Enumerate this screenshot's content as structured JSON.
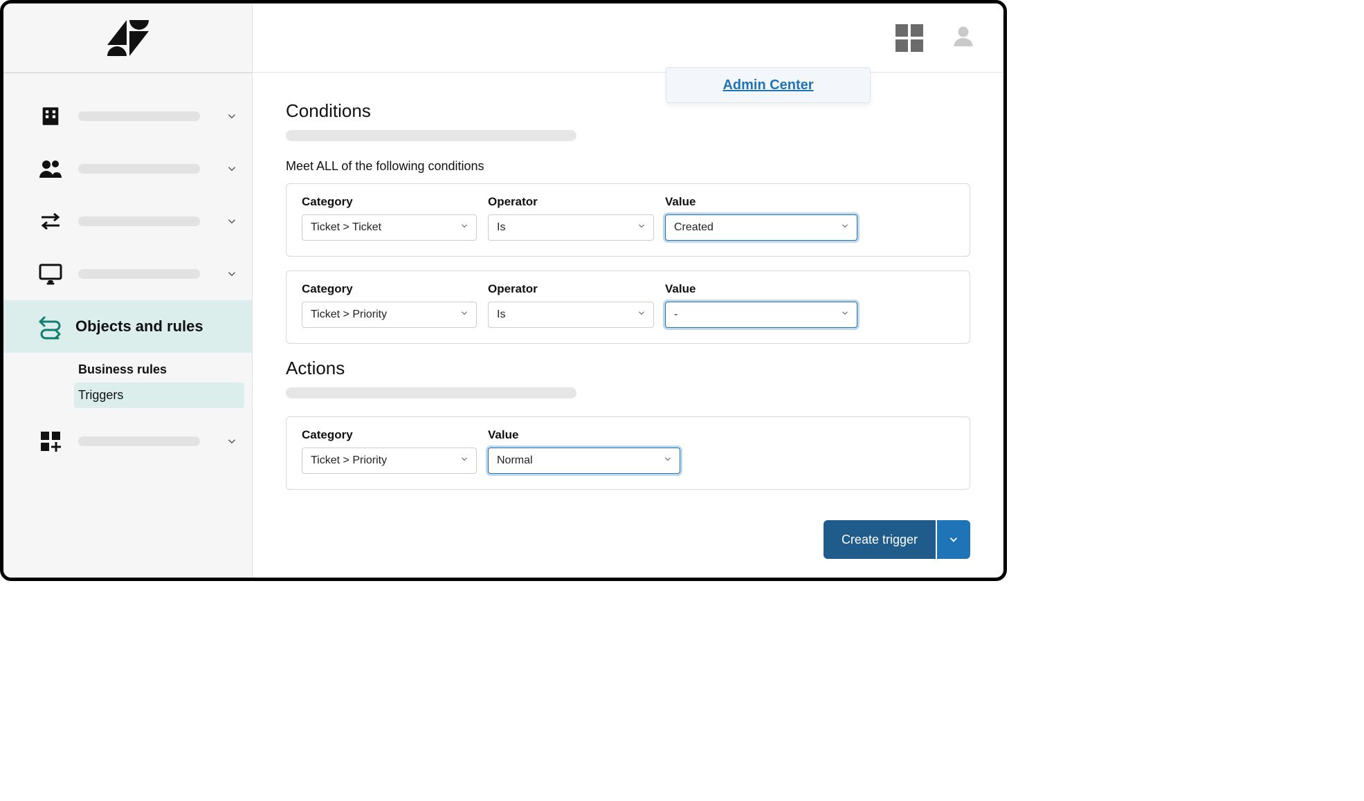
{
  "header": {
    "admin_center_label": "Admin Center"
  },
  "sidebar": {
    "active_label": "Objects and rules",
    "sub_heading": "Business rules",
    "sub_item_selected": "Triggers"
  },
  "sections": {
    "conditions_title": "Conditions",
    "conditions_all_label": "Meet ALL of the following conditions",
    "actions_title": "Actions"
  },
  "labels": {
    "category": "Category",
    "operator": "Operator",
    "value": "Value"
  },
  "conditions": [
    {
      "category": "Ticket > Ticket",
      "operator": "Is",
      "value": "Created"
    },
    {
      "category": "Ticket > Priority",
      "operator": "Is",
      "value": "-"
    }
  ],
  "actions": [
    {
      "category": "Ticket > Priority",
      "value": "Normal"
    }
  ],
  "footer": {
    "create_label": "Create trigger"
  }
}
